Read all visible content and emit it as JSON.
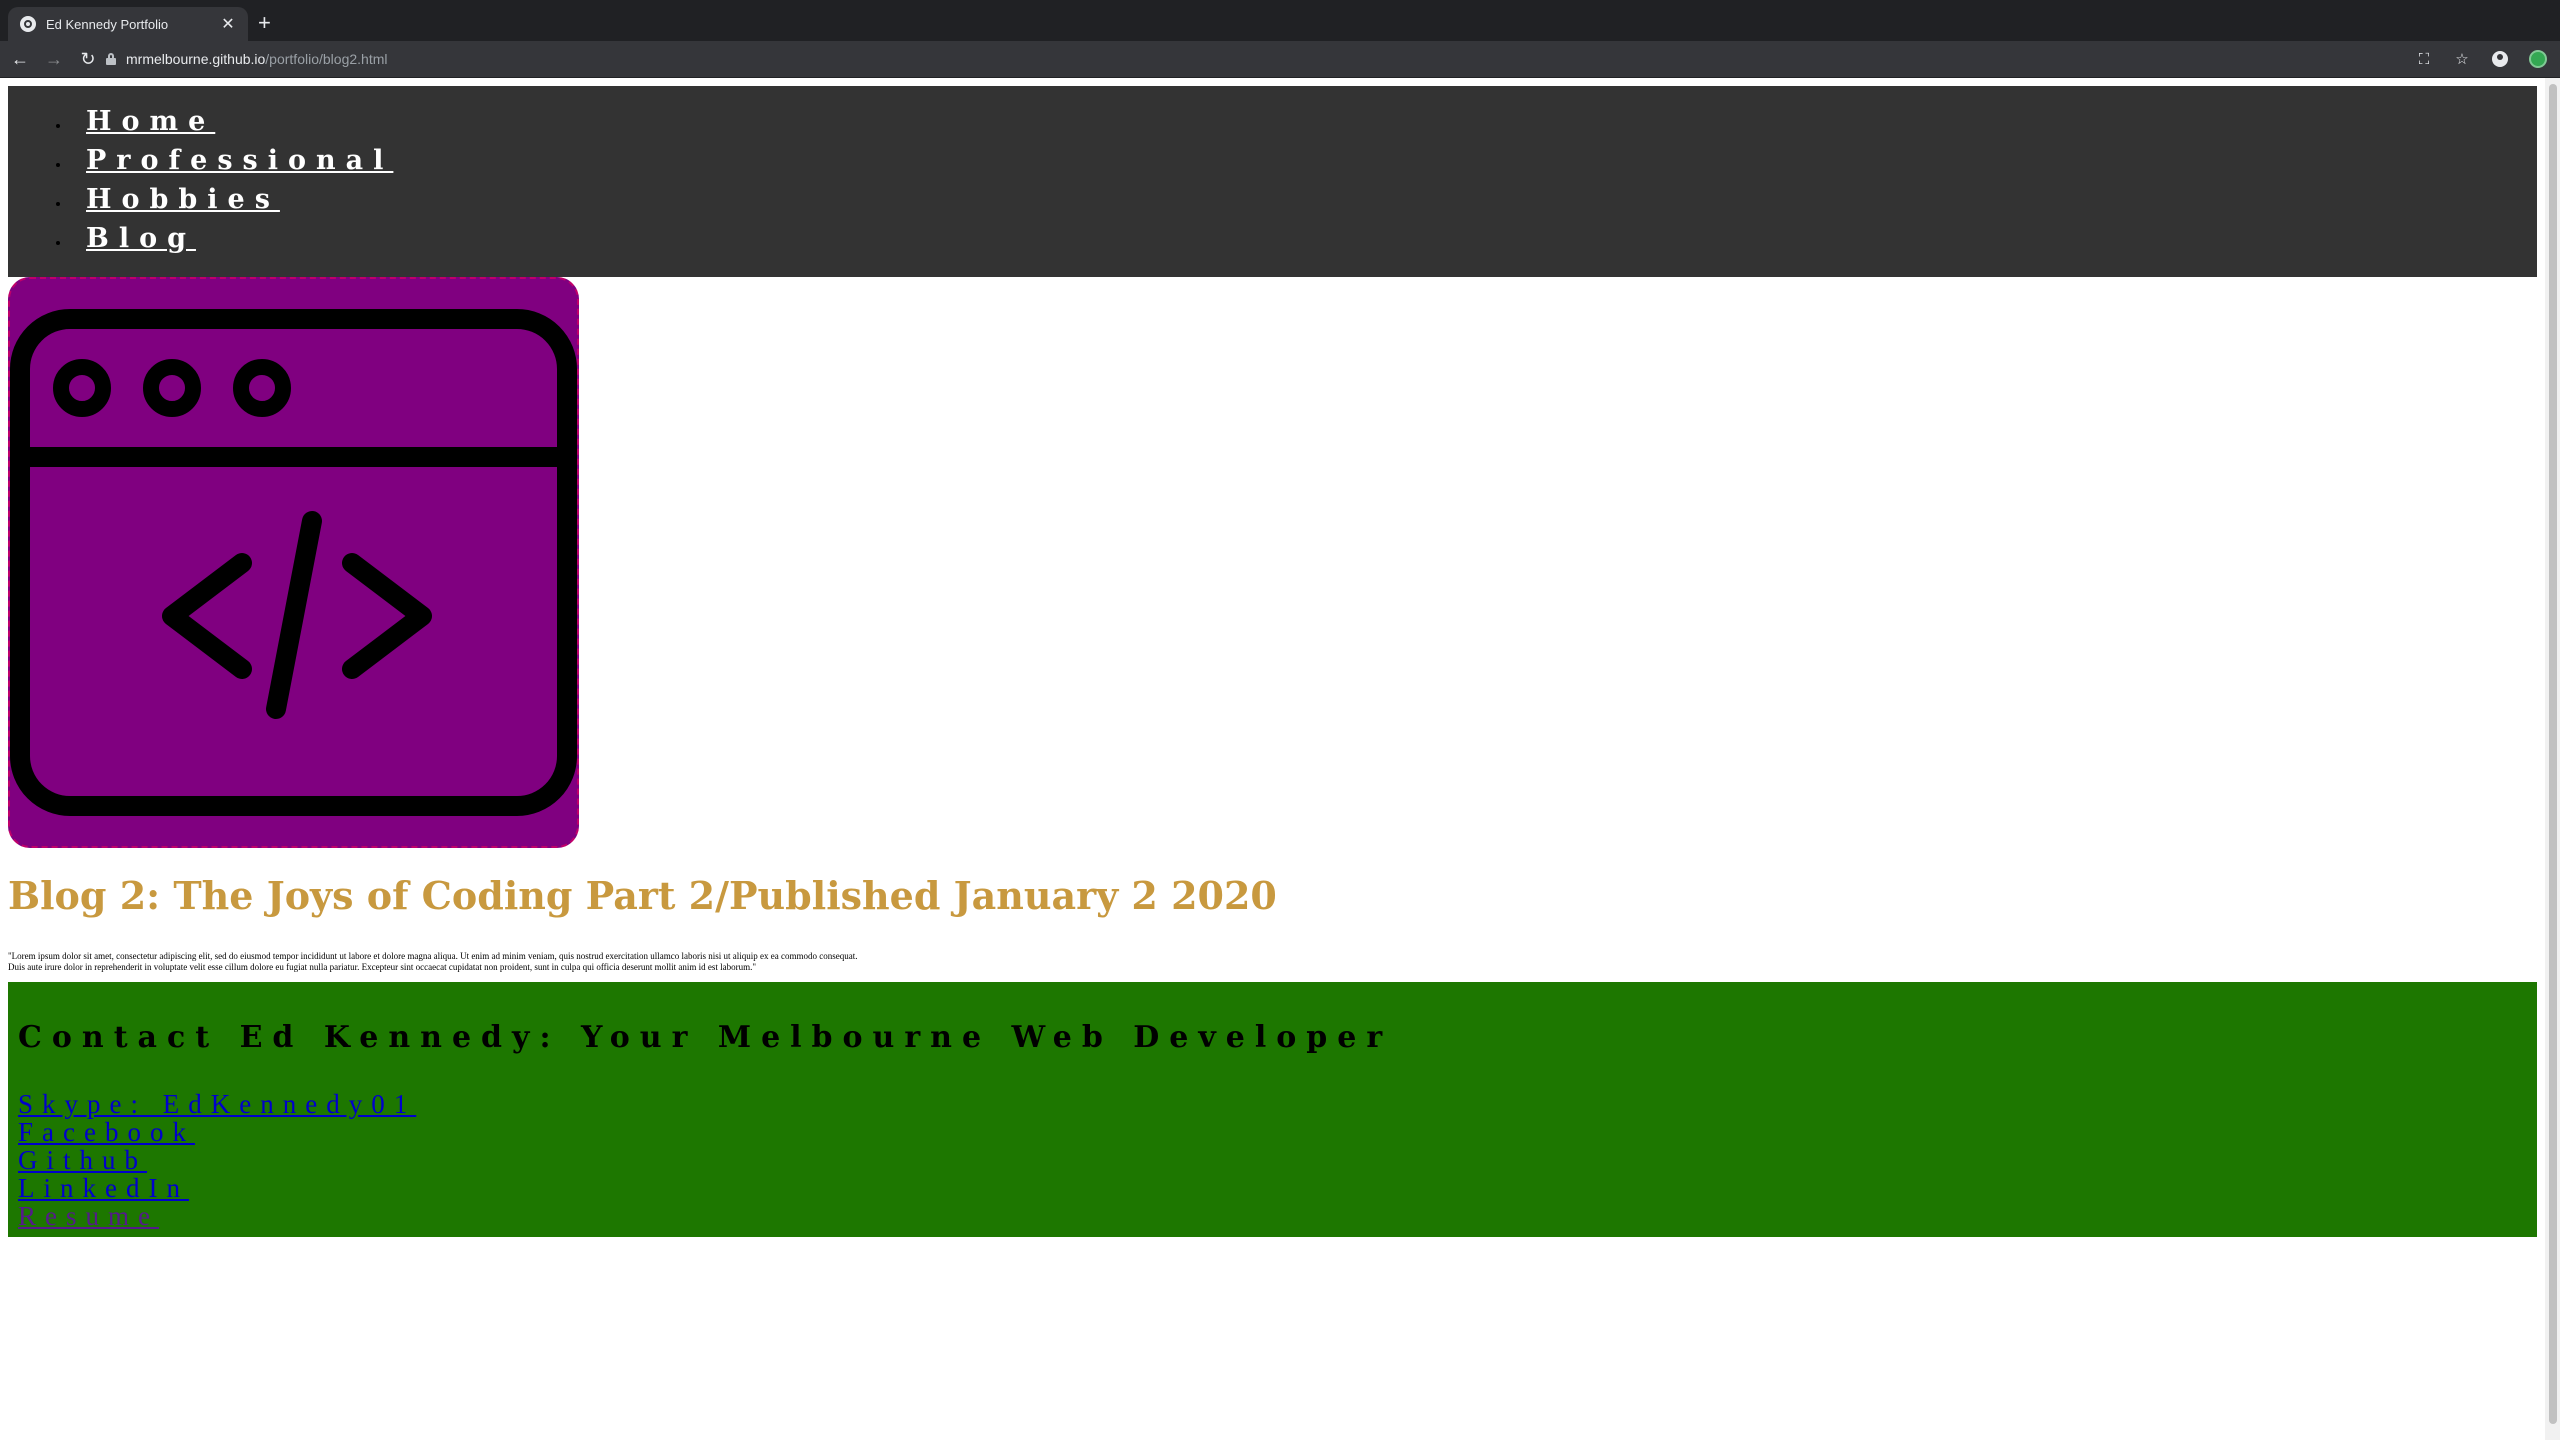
{
  "browser": {
    "tab_title": "Ed Kennedy Portfolio",
    "tab_close": "✕",
    "new_tab": "+",
    "back": "←",
    "forward": "→",
    "reload": "↻",
    "url_host": "mrmelbourne.github.io",
    "url_path": "/portfolio/blog2.html",
    "icons": [
      "translate-icon",
      "star-icon",
      "profile-icon",
      "extension-icon"
    ],
    "translate_glyph": "⛶",
    "star_glyph": "☆"
  },
  "nav": {
    "items": [
      {
        "label": "Home"
      },
      {
        "label": "Professional"
      },
      {
        "label": "Hobbies"
      },
      {
        "label": "Blog"
      }
    ]
  },
  "hero": {
    "icon": "code-window-icon",
    "background_color": "#800080"
  },
  "blog": {
    "title": "Blog 2: The Joys of Coding Part 2/Published January 2 2020",
    "body_line1": "\"Lorem ipsum dolor sit amet, consectetur adipiscing elit, sed do eiusmod tempor incididunt ut labore et dolore magna aliqua. Ut enim ad minim veniam, quis nostrud exercitation ullamco laboris nisi ut aliquip ex ea commodo consequat.",
    "body_line2": "Duis aute irure dolor in reprehenderit in voluptate velit esse cillum dolore eu fugiat nulla pariatur. Excepteur sint occaecat cupidatat non proident, sunt in culpa qui officia deserunt mollit anim id est laborum.\""
  },
  "contact": {
    "heading": "Contact Ed Kennedy: Your Melbourne Web Developer",
    "links": [
      {
        "label": "Skype: EdKennedy01"
      },
      {
        "label": "Facebook"
      },
      {
        "label": "Github"
      },
      {
        "label": "LinkedIn"
      },
      {
        "label": "Resume"
      }
    ],
    "background_color": "#1d7700"
  },
  "colors": {
    "nav_bg": "#333333",
    "title_color": "#c8993f",
    "link_color": "#0000cc",
    "visited_link_color": "#551a8b"
  }
}
